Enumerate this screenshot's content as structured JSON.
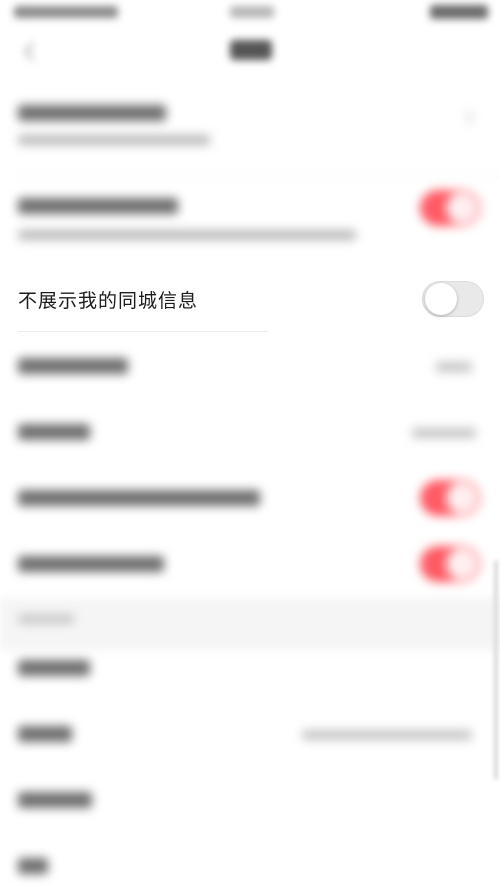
{
  "setting": {
    "hide_local_info_label": "不展示我的同城信息",
    "hide_local_info_enabled": false
  },
  "colors": {
    "accent_toggle_on": "#ff5a64",
    "toggle_off_track": "#e9e9ea",
    "background": "#ffffff",
    "section_gap": "#f5f5f5"
  }
}
